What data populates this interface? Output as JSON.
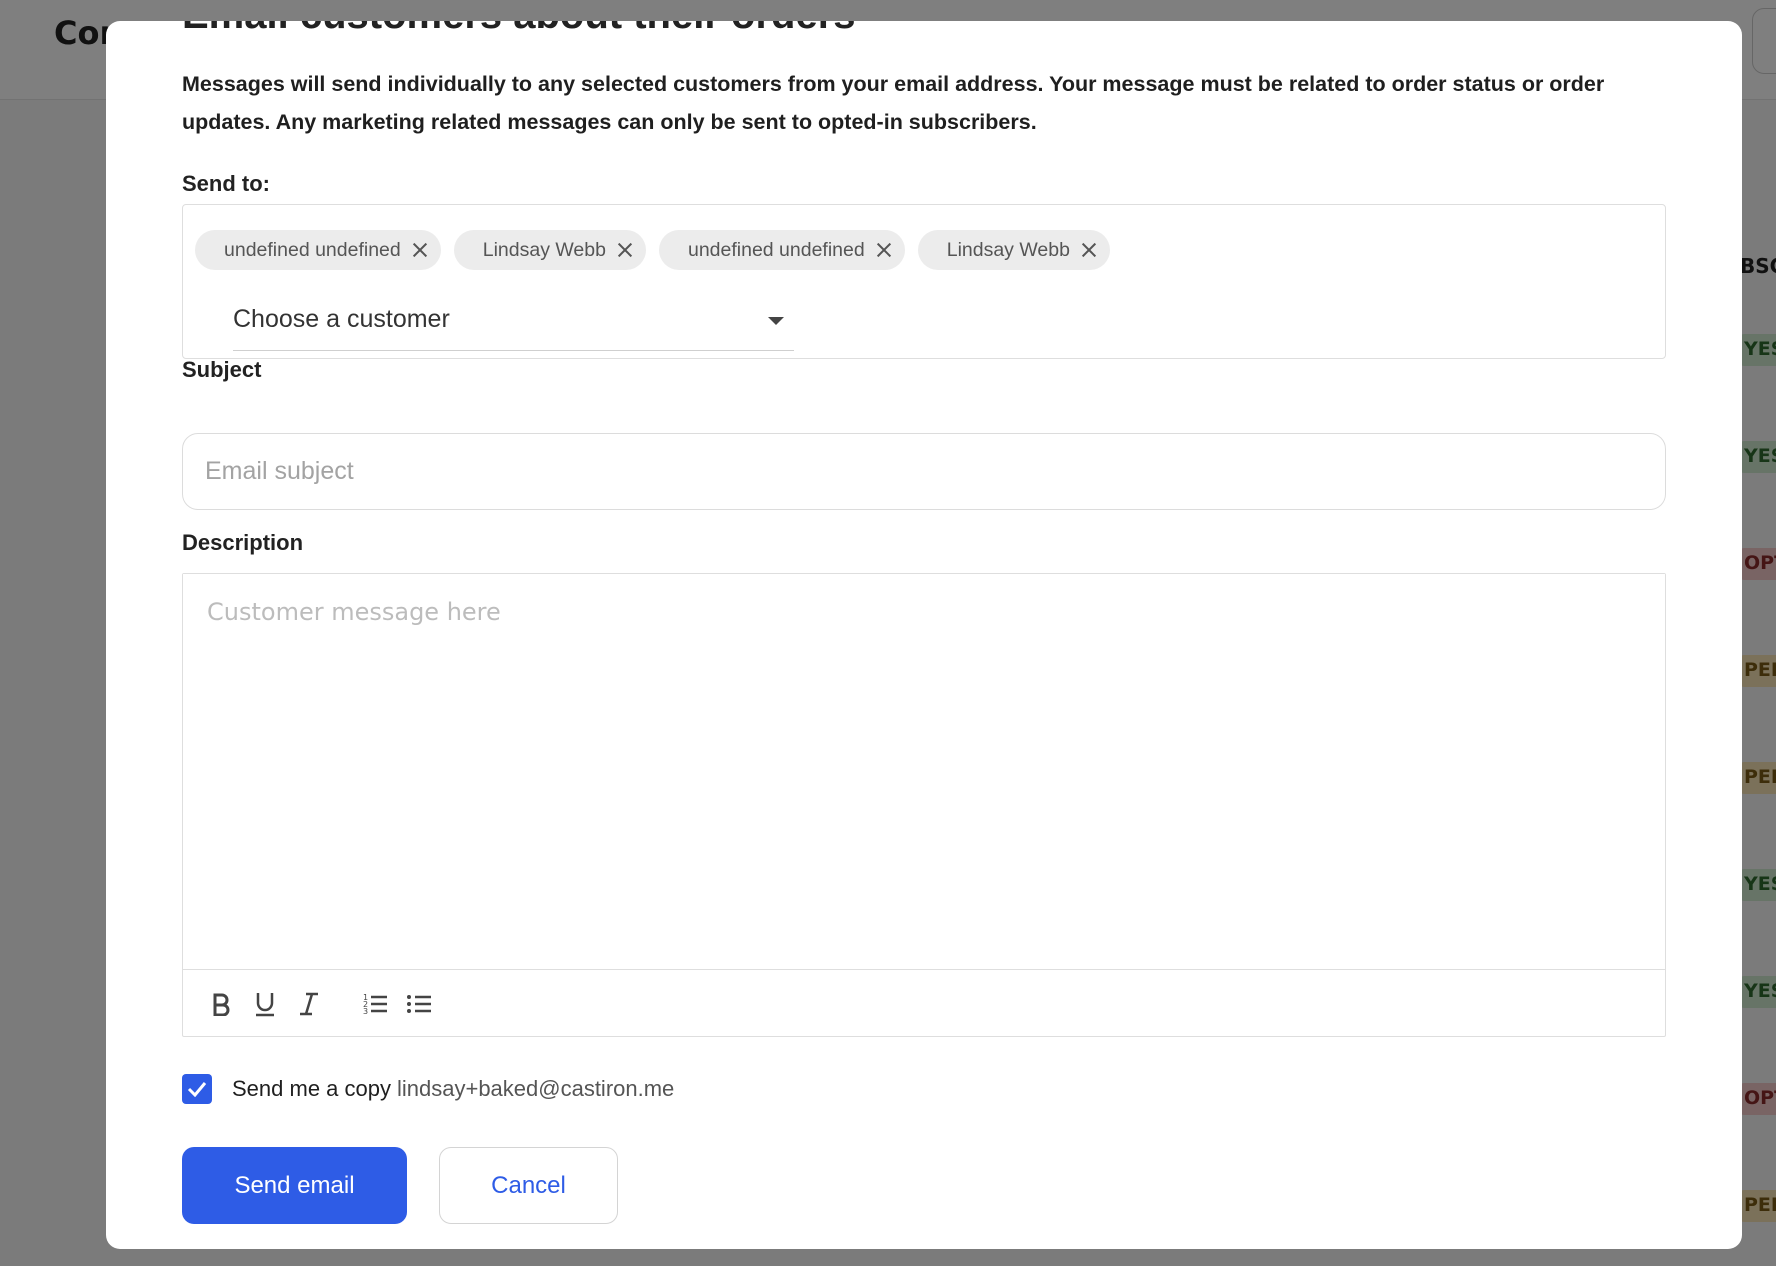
{
  "background": {
    "page_title": "Cor",
    "column_header": "BSC",
    "badges": [
      "YES",
      "YES",
      "OPT",
      "PEN",
      "PEN",
      "YES",
      "YES",
      "OPT",
      "PEN"
    ]
  },
  "modal": {
    "title": "Email customers about their orders",
    "intro": "Messages will send individually to any selected customers from your email address. Your message must be related to order status or order updates. Any marketing related messages can only be sent to opted-in subscribers.",
    "send_to": {
      "label": "Send to:",
      "chips": [
        "undefined undefined",
        "Lindsay Webb",
        "undefined undefined",
        "Lindsay Webb"
      ],
      "select_value": "Choose a customer"
    },
    "subject": {
      "label": "Subject",
      "placeholder": "Email subject"
    },
    "description": {
      "label": "Description",
      "placeholder": "Customer message here",
      "toolbar_icons": [
        "bold-icon",
        "underline-icon",
        "italic-icon",
        "ordered-list-icon",
        "bullet-list-icon"
      ]
    },
    "copy": {
      "label": "Send me a copy",
      "email": "lindsay+baked@castiron.me",
      "checked": true
    },
    "buttons": {
      "send": "Send email",
      "cancel": "Cancel"
    }
  },
  "colors": {
    "primary": "#2e5ce6",
    "overlay": "rgba(0,0,0,0.5)"
  }
}
